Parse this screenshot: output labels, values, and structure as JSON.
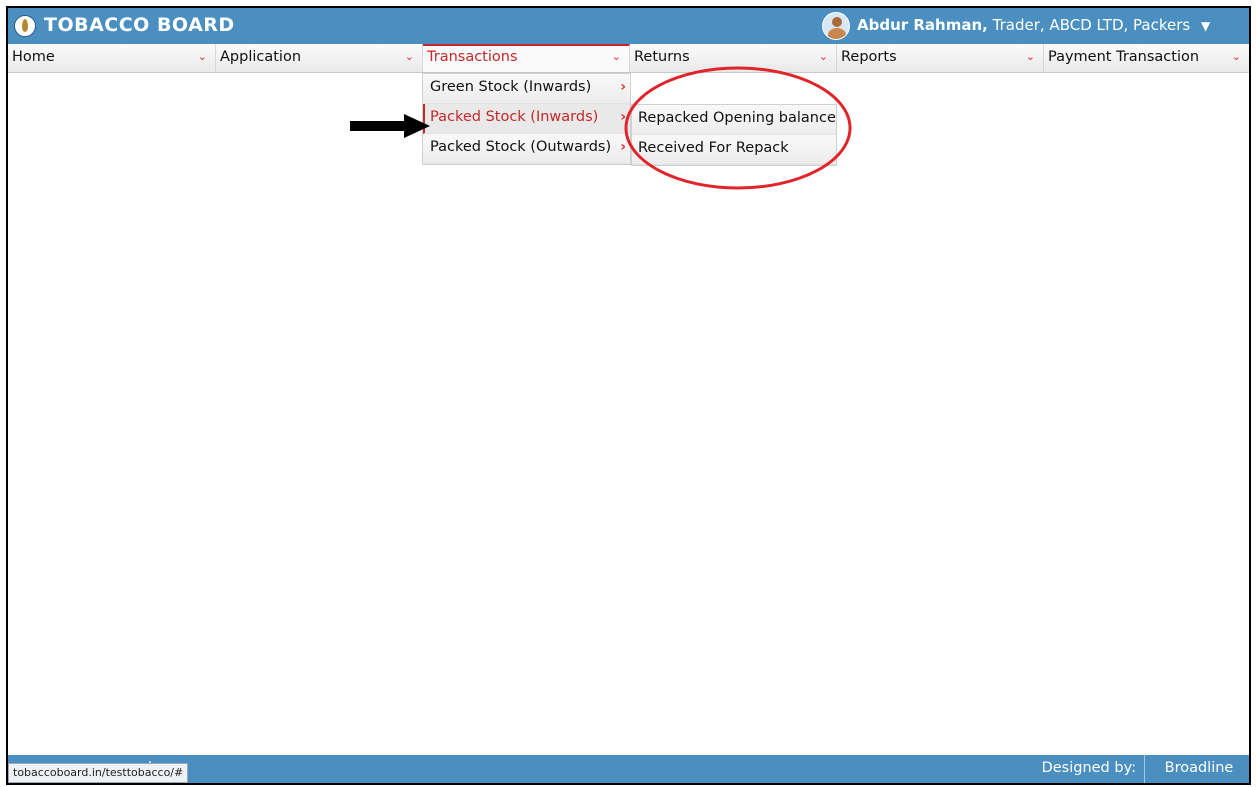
{
  "header": {
    "brand": "TOBACCO BOARD",
    "user_name": "Abdur Rahman,",
    "user_details": "Trader, ABCD LTD, Packers",
    "user_caret": "▼"
  },
  "menu": {
    "items": [
      {
        "label": "Home"
      },
      {
        "label": "Application"
      },
      {
        "label": "Transactions"
      },
      {
        "label": "Returns"
      },
      {
        "label": "Reports"
      },
      {
        "label": "Payment Transaction"
      }
    ],
    "chevron": "⌄",
    "active_index": 2
  },
  "transactions_dropdown": {
    "items": [
      {
        "label": "Green Stock (Inwards)"
      },
      {
        "label": "Packed Stock (Inwards)"
      },
      {
        "label": "Packed Stock (Outwards)"
      }
    ],
    "arrow": "›",
    "hover_index": 1
  },
  "packed_inwards_submenu": {
    "items": [
      {
        "label": "Repacked Opening balance"
      },
      {
        "label": "Received For Repack"
      }
    ]
  },
  "footer": {
    "left_text": "ard",
    "status_url": "tobaccoboard.in/testtobacco/#",
    "designed_by": "Designed by:",
    "designer": "Broadline"
  },
  "colors": {
    "header_blue": "#4a8fc0",
    "active_red": "#c62828",
    "annotation_red": "#e0242a"
  }
}
